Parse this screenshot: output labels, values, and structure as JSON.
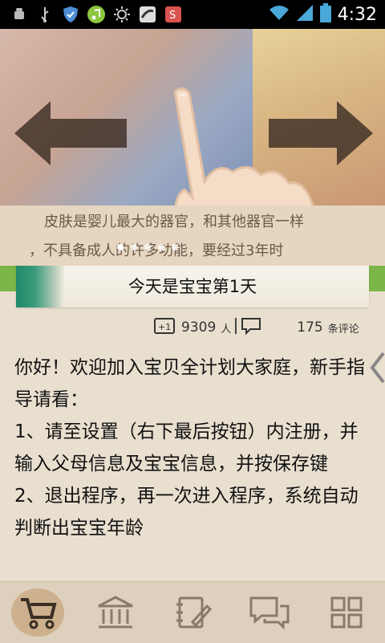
{
  "status_bar": {
    "time": "4:32",
    "left_icons": [
      "android-debug-icon",
      "usb-icon",
      "shield-icon",
      "music-icon",
      "brightness-icon",
      "peapod-icon",
      "app-s-icon"
    ],
    "right_icons": [
      "wifi-icon",
      "signal-icon",
      "battery-icon"
    ]
  },
  "banner": {
    "caption_line1": "皮肤是婴儿最大的器官，和其他器官一样",
    "caption_line2": "，不具备成人的许多功能，要经过3年时",
    "page_count": 5,
    "active_index": 0
  },
  "title": "今天是宝宝第1天",
  "stats": {
    "likes": "9309",
    "likes_unit": "人",
    "comments": "175",
    "comments_unit": "条评论"
  },
  "article": [
    "你好！欢迎加入宝贝全计划大家庭，新手指导请看：",
    "1、请至设置（右下最后按钮）内注册，并输入父母信息及宝宝信息，并按保存键",
    "2、退出程序，再一次进入程序，系统自动判断出宝宝年龄"
  ],
  "bottom_nav": [
    {
      "name": "stroller-icon",
      "active": true
    },
    {
      "name": "bank-icon",
      "active": false
    },
    {
      "name": "notebook-icon",
      "active": false
    },
    {
      "name": "chat-icon",
      "active": false
    },
    {
      "name": "grid-icon",
      "active": false
    }
  ]
}
